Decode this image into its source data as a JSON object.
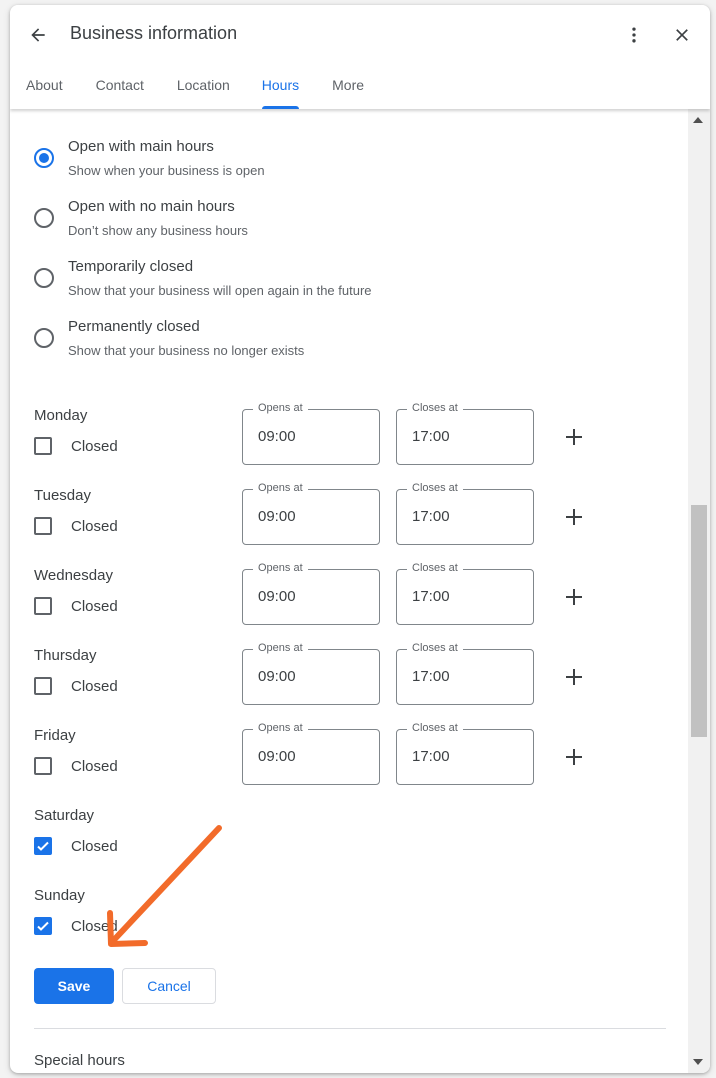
{
  "header": {
    "title": "Business information",
    "back_icon": "arrow-back-icon",
    "more_icon": "more-vert-icon",
    "close_icon": "close-icon"
  },
  "tabs": [
    {
      "label": "About",
      "active": false
    },
    {
      "label": "Contact",
      "active": false
    },
    {
      "label": "Location",
      "active": false
    },
    {
      "label": "Hours",
      "active": true
    },
    {
      "label": "More",
      "active": false
    }
  ],
  "status_options": [
    {
      "title": "Open with main hours",
      "subtitle": "Show when your business is open",
      "selected": true
    },
    {
      "title": "Open with no main hours",
      "subtitle": "Don’t show any business hours",
      "selected": false
    },
    {
      "title": "Temporarily closed",
      "subtitle": "Show that your business will open again in the future",
      "selected": false
    },
    {
      "title": "Permanently closed",
      "subtitle": "Show that your business no longer exists",
      "selected": false
    }
  ],
  "hours": {
    "closed_label": "Closed",
    "opens_label": "Opens at",
    "closes_label": "Closes at",
    "days": [
      {
        "name": "Monday",
        "closed": false,
        "opens": "09:00",
        "closes": "17:00"
      },
      {
        "name": "Tuesday",
        "closed": false,
        "opens": "09:00",
        "closes": "17:00"
      },
      {
        "name": "Wednesday",
        "closed": false,
        "opens": "09:00",
        "closes": "17:00"
      },
      {
        "name": "Thursday",
        "closed": false,
        "opens": "09:00",
        "closes": "17:00"
      },
      {
        "name": "Friday",
        "closed": false,
        "opens": "09:00",
        "closes": "17:00"
      },
      {
        "name": "Saturday",
        "closed": true
      },
      {
        "name": "Sunday",
        "closed": true
      }
    ]
  },
  "actions": {
    "save_label": "Save",
    "cancel_label": "Cancel"
  },
  "special_hours_label": "Special hours",
  "colors": {
    "accent": "#1a73e8",
    "annotation_arrow": "#f26b2a"
  }
}
